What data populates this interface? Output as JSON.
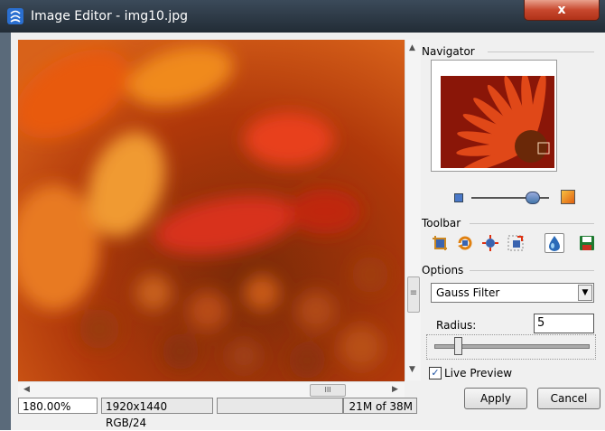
{
  "window": {
    "title": "Image Editor - img10.jpg",
    "close_label": "x"
  },
  "status": {
    "zoom": "180.00%",
    "dimensions": "1920x1440 RGB/24",
    "memory": "21M of 38M"
  },
  "navigator": {
    "label": "Navigator"
  },
  "toolbar": {
    "label": "Toolbar",
    "tools": [
      "crop-icon",
      "rotate-icon",
      "adjust-icon",
      "resize-icon",
      "blur-icon",
      "save-icon"
    ],
    "active_tool": "blur-icon"
  },
  "options": {
    "label": "Options",
    "filter_value": "Gauss Filter",
    "radius_label": "Radius:",
    "radius_value": "5",
    "live_preview_label": "Live Preview",
    "live_preview_checked": true
  },
  "buttons": {
    "apply": "Apply",
    "cancel": "Cancel"
  },
  "scrollbar": {
    "h_thumb_glyph": "III",
    "v_thumb_glyph": "≡"
  },
  "colors": {
    "title_bar": "#2d3945",
    "close": "#c8482e",
    "image_primary": "#c8401a"
  }
}
